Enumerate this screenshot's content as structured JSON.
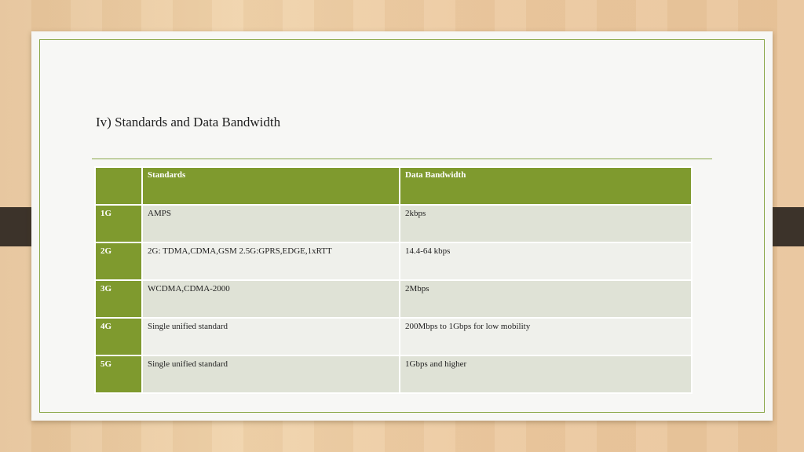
{
  "slide": {
    "title": "Iv) Standards and Data Bandwidth"
  },
  "table": {
    "headers": [
      "",
      "Standards",
      "Data Bandwidth"
    ],
    "rows": [
      {
        "gen": "1G",
        "standard": "AMPS",
        "bandwidth": "2kbps"
      },
      {
        "gen": "2G",
        "standard": "2G: TDMA,CDMA,GSM 2.5G:GPRS,EDGE,1xRTT",
        "bandwidth": "14.4-64 kbps"
      },
      {
        "gen": "3G",
        "standard": "WCDMA,CDMA-2000",
        "bandwidth": "2Mbps"
      },
      {
        "gen": "4G",
        "standard": "Single unified standard",
        "bandwidth": "200Mbps to 1Gbps for low mobility"
      },
      {
        "gen": "5G",
        "standard": "Single unified standard",
        "bandwidth": "1Gbps and higher"
      }
    ]
  },
  "colors": {
    "header_green": "#7f9a2e",
    "frame_green": "#8aa84a",
    "row_dark": "#dfe2d6",
    "row_light": "#eff0eb",
    "side_tab": "#3c332a"
  }
}
